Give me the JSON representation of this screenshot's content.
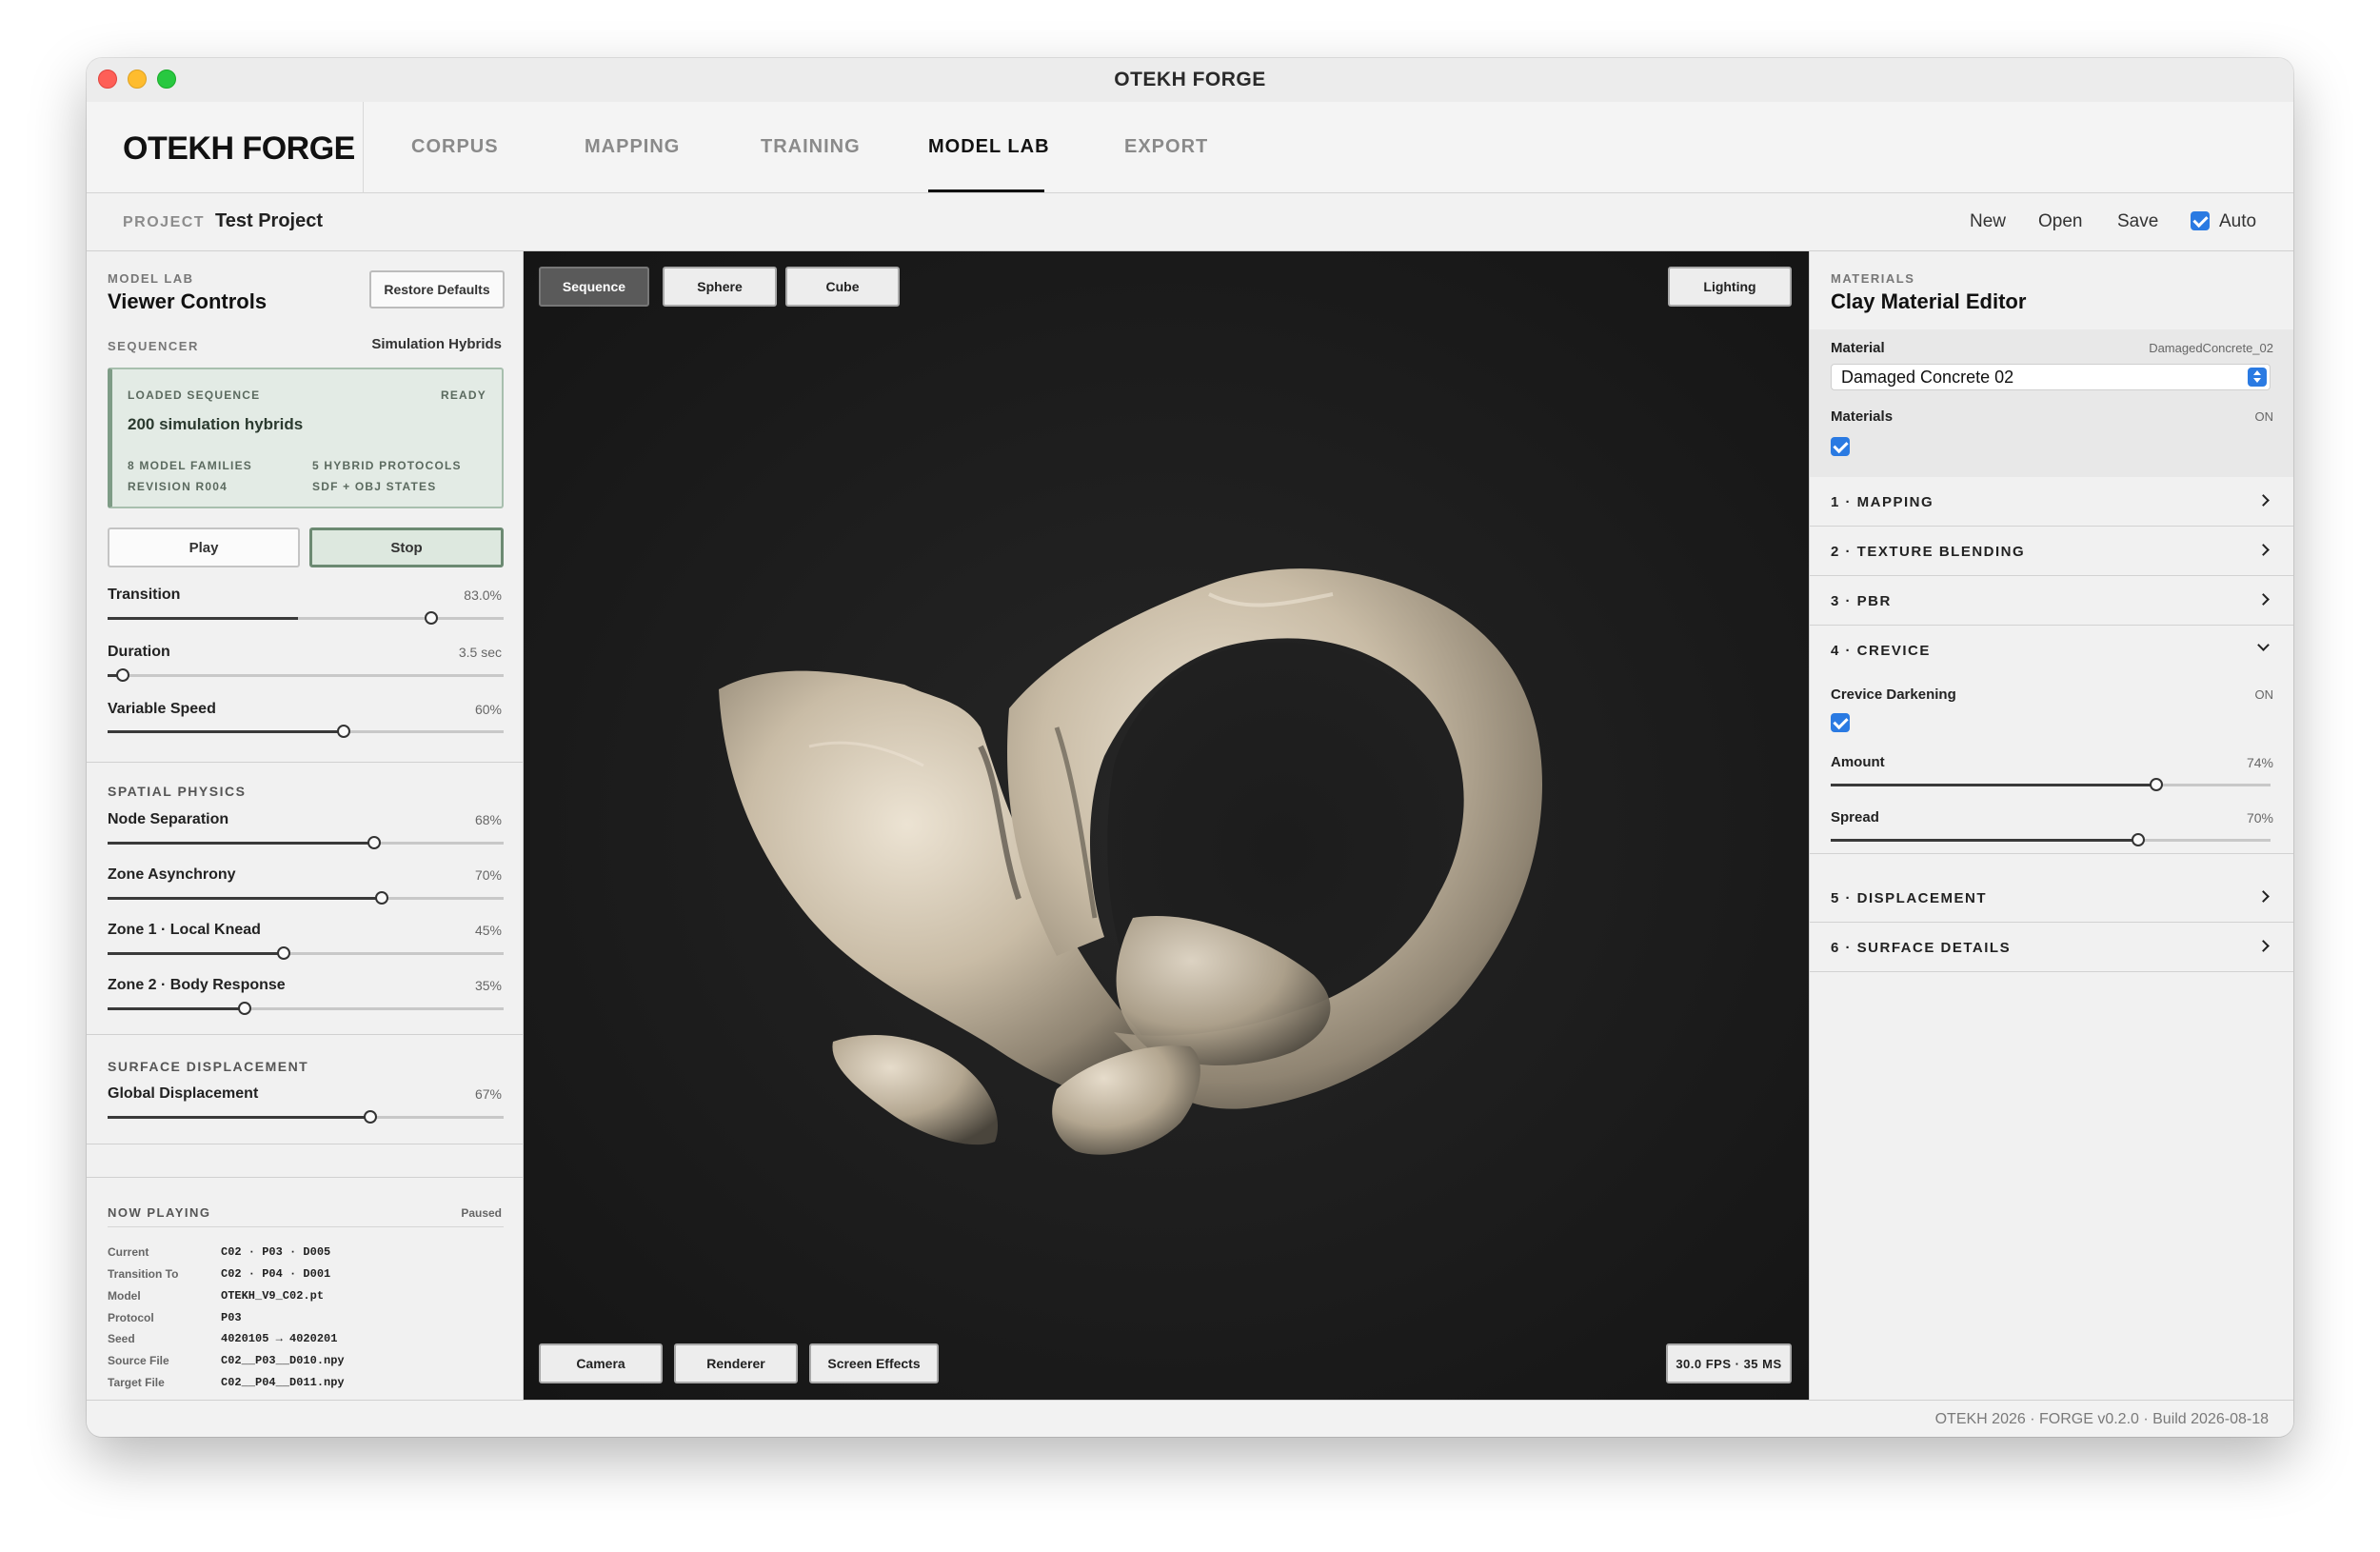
{
  "window": {
    "title": "OTEKH FORGE"
  },
  "brand": "OTEKH FORGE",
  "nav": {
    "tabs": [
      "CORPUS",
      "MAPPING",
      "TRAINING",
      "MODEL LAB",
      "EXPORT"
    ]
  },
  "project": {
    "label": "PROJECT",
    "name": "Test Project",
    "actions": [
      "New",
      "Open",
      "Save"
    ],
    "auto_label": "Auto"
  },
  "left": {
    "eyebrow": "MODEL LAB",
    "title": "Viewer Controls",
    "restore": "Restore Defaults",
    "sequencer": {
      "label": "SEQUENCER",
      "value": "Simulation Hybrids"
    },
    "card": {
      "loaded": "LOADED SEQUENCE",
      "status": "READY",
      "name": "200 simulation hybrids",
      "families": "8 MODEL FAMILIES",
      "protocols": "5 HYBRID PROTOCOLS",
      "revision": "REVISION R004",
      "states": "SDF + OBJ STATES"
    },
    "play": "Play",
    "stop": "Stop",
    "sliders_top": [
      {
        "label": "Transition",
        "value": "83.0%",
        "level": 0.83
      },
      {
        "label": "Duration",
        "value": "3.5 sec",
        "level": 0.04
      },
      {
        "label": "Variable Speed",
        "value": "60%",
        "level": 0.6
      }
    ],
    "spatial": {
      "title": "SPATIAL PHYSICS",
      "sliders": [
        {
          "label": "Node Separation",
          "value": "68%",
          "level": 0.68
        },
        {
          "label": "Zone Asynchrony",
          "value": "70%",
          "level": 0.7
        },
        {
          "label": "Zone 1 · Local Knead",
          "value": "45%",
          "level": 0.45
        },
        {
          "label": "Zone 2 · Body Response",
          "value": "35%",
          "level": 0.35
        }
      ]
    },
    "surface": {
      "title": "SURFACE DISPLACEMENT",
      "sliders": [
        {
          "label": "Global Displacement",
          "value": "67%",
          "level": 0.67
        }
      ]
    },
    "now_playing": {
      "title": "NOW PLAYING",
      "status": "Paused",
      "rows": [
        {
          "k": "Current",
          "v": "C02 · P03 · D005"
        },
        {
          "k": "Transition To",
          "v": "C02 · P04 · D001"
        },
        {
          "k": "Model",
          "v": "OTEKH_V9_C02.pt"
        },
        {
          "k": "Protocol",
          "v": "P03"
        },
        {
          "k": "Seed",
          "v": "4020105 → 4020201"
        },
        {
          "k": "Source File",
          "v": "C02__P03__D010.npy"
        },
        {
          "k": "Target File",
          "v": "C02__P04__D011.npy"
        }
      ]
    }
  },
  "viewport": {
    "top_buttons": [
      "Sequence",
      "Sphere",
      "Cube"
    ],
    "lighting": "Lighting",
    "bottom_buttons": [
      "Camera",
      "Renderer",
      "Screen Effects"
    ],
    "fps": "30.0 FPS · 35 MS"
  },
  "right": {
    "eyebrow": "MATERIALS",
    "title": "Clay Material Editor",
    "material_label": "Material",
    "material_id": "DamagedConcrete_02",
    "material_value": "Damaged Concrete 02",
    "materials_label": "Materials",
    "materials_state": "ON",
    "sections": [
      "1 · MAPPING",
      "2 · TEXTURE BLENDING",
      "3 · PBR",
      "4 · CREVICE",
      "5 · DISPLACEMENT",
      "6 · SURFACE DETAILS"
    ],
    "crevice": {
      "darkening_label": "Crevice Darkening",
      "darkening_state": "ON",
      "sliders": [
        {
          "label": "Amount",
          "value": "74%",
          "level": 0.74
        },
        {
          "label": "Spread",
          "value": "70%",
          "level": 0.7
        }
      ]
    }
  },
  "footer": "OTEKH 2026 · FORGE v0.2.0 · Build 2026-08-18"
}
